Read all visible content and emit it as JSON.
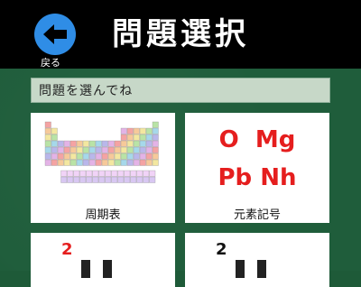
{
  "header": {
    "title": "問題選択",
    "back_label": "戻る",
    "back_icon": "arrow-left-icon"
  },
  "prompt": "問題を選んでね",
  "cards": [
    {
      "label": "周期表"
    },
    {
      "label": "元素記号",
      "symbols_row1": "O  Mg",
      "symbols_row2": "Pb Nh"
    },
    {
      "badge": "2"
    },
    {
      "badge": "2"
    }
  ],
  "colors": {
    "header_bg": "#000000",
    "board_green": "#1f5d3b",
    "accent_blue": "#2f8de6",
    "symbol_red": "#e51e1e"
  }
}
